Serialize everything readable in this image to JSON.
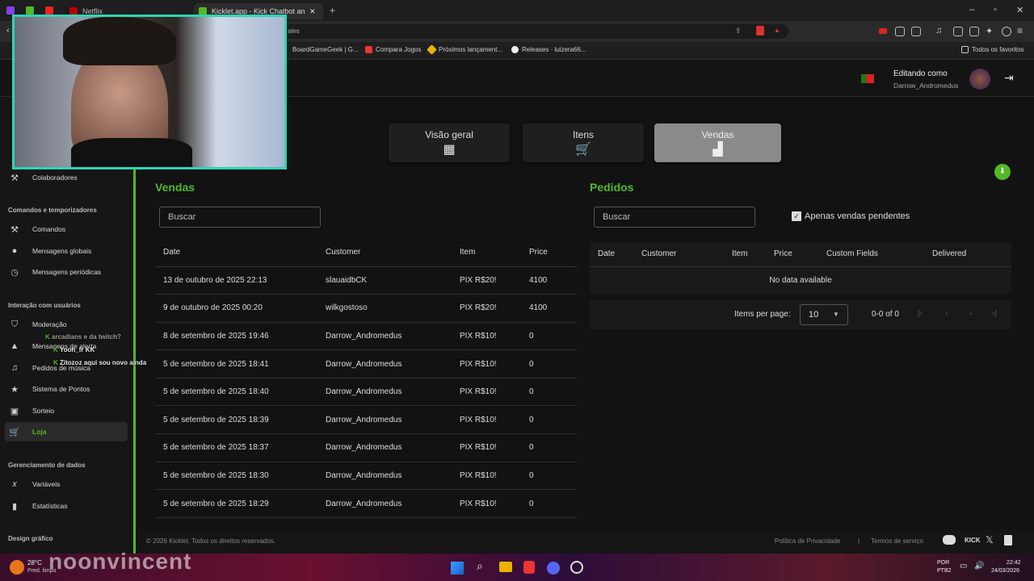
{
  "browser": {
    "tabs": [
      {
        "label": ""
      },
      {
        "label": ""
      },
      {
        "label": ""
      },
      {
        "label": "Netflix"
      },
      {
        "label": "Kicklet.app - Kick Chatbot and C"
      }
    ],
    "address_fragment": "ales",
    "bookmarks": [
      "BoardGameGeek | G...",
      "Compara Jogos",
      "Próximos lançament...",
      "Releases · luizera66..."
    ],
    "favorites_label": "Todos os favoritos",
    "colors": {
      "accent": "#53b827",
      "teal": "#2fd5b5"
    }
  },
  "header": {
    "editing_as": "Editando como",
    "username": "Darrow_Andromedus"
  },
  "sidebar": {
    "items_top": [
      {
        "label": "Colaboradores",
        "icon": "wrench-icon"
      }
    ],
    "sections": [
      {
        "title": "Comandos e temporizadores",
        "items": [
          {
            "label": "Comandos",
            "icon": "wrench-icon"
          },
          {
            "label": "Mensagens globais",
            "icon": "chat-icon"
          },
          {
            "label": "Mensagens periódicas",
            "icon": "clock-icon"
          }
        ]
      },
      {
        "title": "Interação com usuários",
        "items": [
          {
            "label": "Moderação",
            "icon": "shield-icon"
          },
          {
            "label": "Mensagens de alerta",
            "icon": "alert-icon"
          },
          {
            "label": "Pedidos de música",
            "icon": "music-icon"
          },
          {
            "label": "Sistema de Pontos",
            "icon": "star-icon"
          },
          {
            "label": "Sorteio",
            "icon": "gift-icon"
          },
          {
            "label": "Loja",
            "icon": "cart-icon"
          }
        ]
      },
      {
        "title": "Gerenciamento de dados",
        "items": [
          {
            "label": "Variáveis",
            "icon": "variable-icon"
          },
          {
            "label": "Estatísticas",
            "icon": "stats-icon"
          }
        ]
      },
      {
        "title": "Design gráfico",
        "items": []
      }
    ]
  },
  "nav_tabs": [
    {
      "label": "Visão geral",
      "icon": "grid-icon"
    },
    {
      "label": "Itens",
      "icon": "cart-icon"
    },
    {
      "label": "Vendas",
      "icon": "register-icon"
    }
  ],
  "sales": {
    "title": "Vendas",
    "search_placeholder": "Buscar",
    "columns": [
      "Date",
      "Customer",
      "Item",
      "Price"
    ],
    "rows": [
      [
        "13 de outubro de 2025 22:13",
        "slauaidbCK",
        "PIX R$20!",
        "4100"
      ],
      [
        "9 de outubro de 2025 00:20",
        "wilkgostoso",
        "PIX R$20!",
        "4100"
      ],
      [
        "8 de setembro de 2025 19:46",
        "Darrow_Andromedus",
        "PIX R$10!",
        "0"
      ],
      [
        "5 de setembro de 2025 18:41",
        "Darrow_Andromedus",
        "PIX R$10!",
        "0"
      ],
      [
        "5 de setembro de 2025 18:40",
        "Darrow_Andromedus",
        "PIX R$10!",
        "0"
      ],
      [
        "5 de setembro de 2025 18:39",
        "Darrow_Andromedus",
        "PIX R$10!",
        "0"
      ],
      [
        "5 de setembro de 2025 18:37",
        "Darrow_Andromedus",
        "PIX R$10!",
        "0"
      ],
      [
        "5 de setembro de 2025 18:30",
        "Darrow_Andromedus",
        "PIX R$10!",
        "0"
      ],
      [
        "5 de setembro de 2025 18:29",
        "Darrow_Andromedus",
        "PIX R$10!",
        "0"
      ]
    ]
  },
  "orders": {
    "title": "Pedidos",
    "search_placeholder": "Buscar",
    "pending_only_label": "Apenas vendas pendentes",
    "columns": [
      "Date",
      "Customer",
      "Item",
      "Price",
      "Custom Fields",
      "Delivered"
    ],
    "empty_text": "No data available",
    "items_per_page_label": "Items per page:",
    "items_per_page_value": "10",
    "range_text": "0-0 of 0"
  },
  "footer": {
    "copyright": "© 2026 Kicklet. Todos os direitos reservados.",
    "privacy": "Política de Privacidade",
    "separator": "|",
    "terms": "Termos de serviço",
    "kick_label": "KICK"
  },
  "chat_overlay": [
    {
      "user": "arcadians",
      "text": "e da twitch?"
    },
    {
      "user": "Yooh_fr",
      "text": "KK"
    },
    {
      "user": "Zitozoz",
      "text": "aqui sou novo ainda"
    }
  ],
  "stream_overlay_name": "noonvincent",
  "taskbar": {
    "weather_temp": "28°C",
    "weather_desc": "Pred. limpo",
    "lang_top": "POR",
    "lang_bottom": "PTB2",
    "time": "22:42",
    "date": "24/03/2026"
  }
}
